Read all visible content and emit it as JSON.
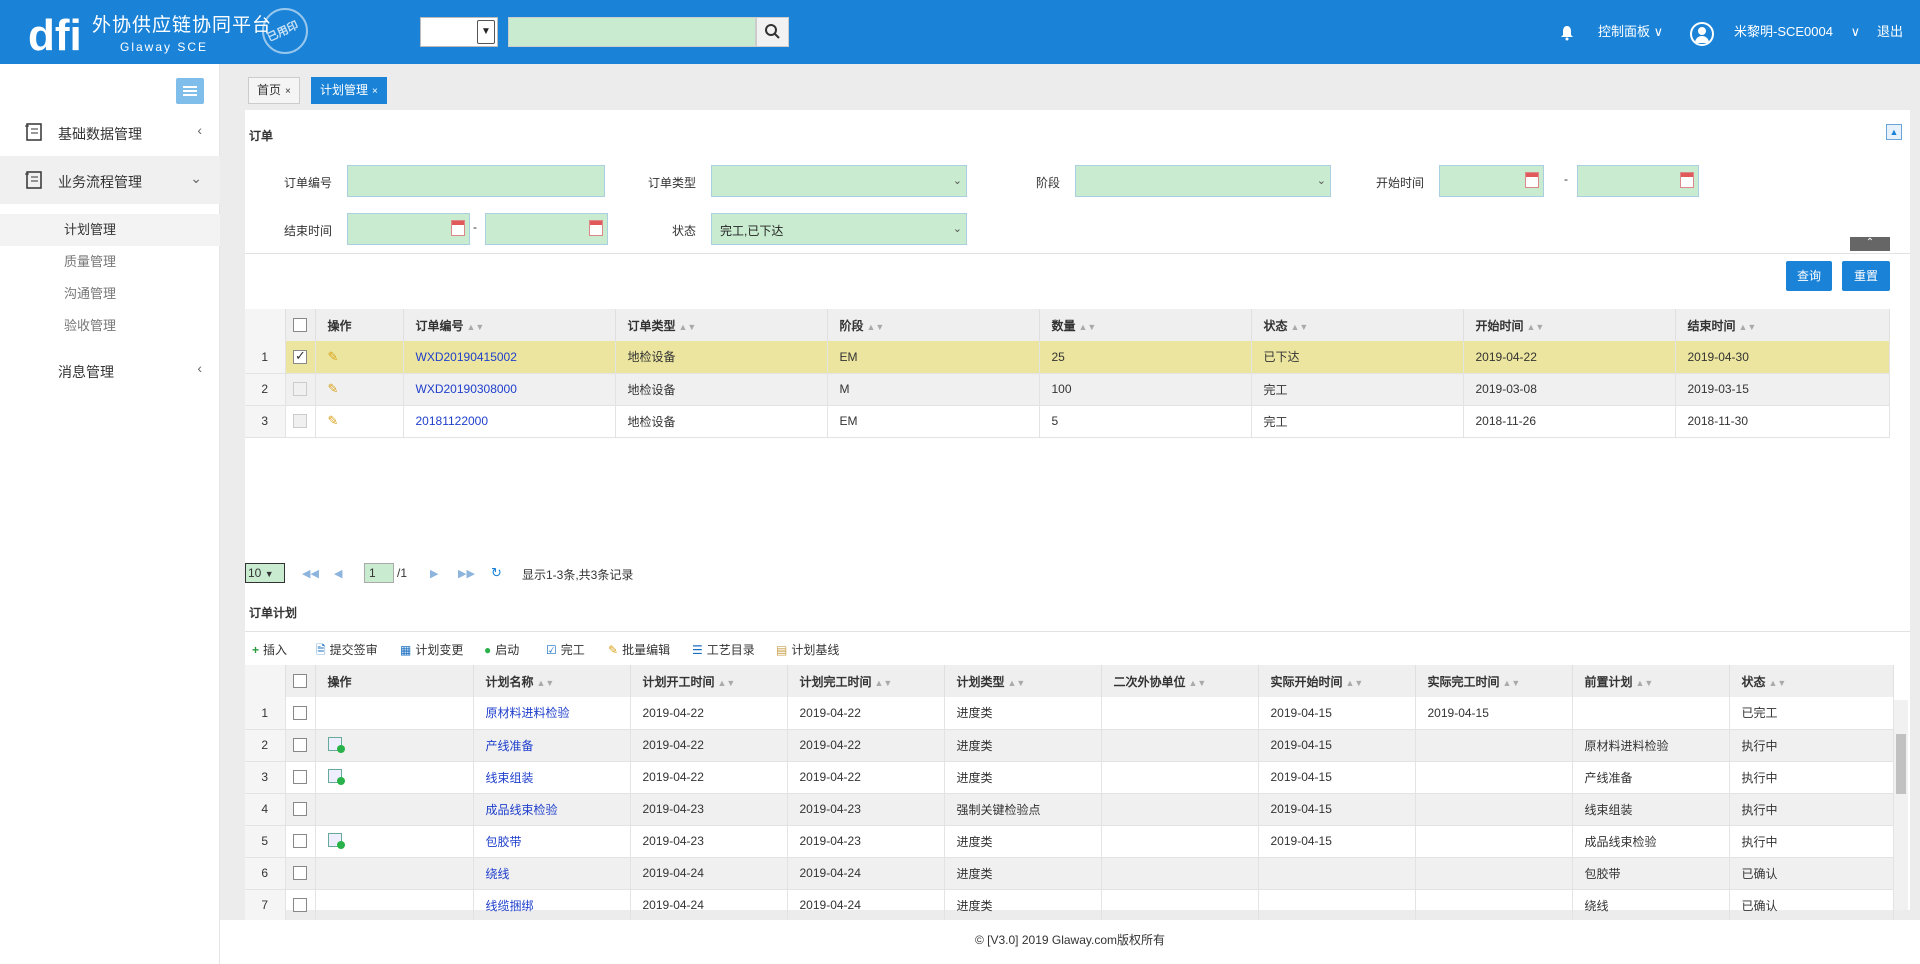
{
  "header": {
    "title": "外协供应链协同平台",
    "subtitle": "Glaway SCE",
    "stamp": "已用印",
    "search_select": "",
    "search_value": "",
    "control_panel": "控制面板",
    "user": "米黎明-SCE0004",
    "logout": "退出"
  },
  "sidebar": {
    "groups": [
      {
        "label": "基础数据管理"
      },
      {
        "label": "业务流程管理"
      },
      {
        "label": "消息管理"
      }
    ],
    "subitems": [
      "计划管理",
      "质量管理",
      "沟通管理",
      "验收管理"
    ]
  },
  "tabs": [
    {
      "label": "首页"
    },
    {
      "label": "计划管理"
    }
  ],
  "order_section": {
    "title": "订单",
    "form": {
      "order_no_label": "订单编号",
      "order_type_label": "订单类型",
      "stage_label": "阶段",
      "start_time_label": "开始时间",
      "end_time_label": "结束时间",
      "status_label": "状态",
      "status_value": "完工,已下达",
      "dash": "-"
    },
    "query_button": "查询",
    "reset_button": "重置",
    "columns": [
      "操作",
      "订单编号",
      "订单类型",
      "阶段",
      "数量",
      "状态",
      "开始时间",
      "结束时间"
    ],
    "rows": [
      {
        "no": "1",
        "order_no": "WXD20190415002",
        "type": "地检设备",
        "stage": "EM",
        "qty": "25",
        "status": "已下达",
        "start": "2019-04-22",
        "end": "2019-04-30"
      },
      {
        "no": "2",
        "order_no": "WXD20190308000",
        "type": "地检设备",
        "stage": "M",
        "qty": "100",
        "status": "完工",
        "start": "2019-03-08",
        "end": "2019-03-15"
      },
      {
        "no": "3",
        "order_no": "20181122000",
        "type": "地检设备",
        "stage": "EM",
        "qty": "5",
        "status": "完工",
        "start": "2018-11-26",
        "end": "2018-11-30"
      }
    ],
    "pager": {
      "page_size": "10",
      "current_page": "1",
      "total_pages": "/1",
      "summary": "显示1-3条,共3条记录"
    }
  },
  "plan_section": {
    "title": "订单计划",
    "toolbar": [
      "插入",
      "提交签审",
      "计划变更",
      "启动",
      "完工",
      "批量编辑",
      "工艺目录",
      "计划基线"
    ],
    "columns": [
      "操作",
      "计划名称",
      "计划开工时间",
      "计划完工时间",
      "计划类型",
      "二次外协单位",
      "实际开始时间",
      "实际完工时间",
      "前置计划",
      "状态"
    ],
    "rows": [
      {
        "no": "1",
        "name": "原材料进料检验",
        "plan_start": "2019-04-22",
        "plan_end": "2019-04-22",
        "type": "进度类",
        "sub": "",
        "act_start": "2019-04-15",
        "act_end": "2019-04-15",
        "pre": "",
        "status": "已完工",
        "icon": false
      },
      {
        "no": "2",
        "name": "产线准备",
        "plan_start": "2019-04-22",
        "plan_end": "2019-04-22",
        "type": "进度类",
        "sub": "",
        "act_start": "2019-04-15",
        "act_end": "",
        "pre": "原材料进料检验",
        "status": "执行中",
        "icon": true
      },
      {
        "no": "3",
        "name": "线束组装",
        "plan_start": "2019-04-22",
        "plan_end": "2019-04-22",
        "type": "进度类",
        "sub": "",
        "act_start": "2019-04-15",
        "act_end": "",
        "pre": "产线准备",
        "status": "执行中",
        "icon": true
      },
      {
        "no": "4",
        "name": "成品线束检验",
        "plan_start": "2019-04-23",
        "plan_end": "2019-04-23",
        "type": "强制关键检验点",
        "sub": "",
        "act_start": "2019-04-15",
        "act_end": "",
        "pre": "线束组装",
        "status": "执行中",
        "icon": false
      },
      {
        "no": "5",
        "name": "包胶带",
        "plan_start": "2019-04-23",
        "plan_end": "2019-04-23",
        "type": "进度类",
        "sub": "",
        "act_start": "2019-04-15",
        "act_end": "",
        "pre": "成品线束检验",
        "status": "执行中",
        "icon": true
      },
      {
        "no": "6",
        "name": "绕线",
        "plan_start": "2019-04-24",
        "plan_end": "2019-04-24",
        "type": "进度类",
        "sub": "",
        "act_start": "",
        "act_end": "",
        "pre": "包胶带",
        "status": "已确认",
        "icon": false
      },
      {
        "no": "7",
        "name": "线缆捆绑",
        "plan_start": "2019-04-24",
        "plan_end": "2019-04-24",
        "type": "进度类",
        "sub": "",
        "act_start": "",
        "act_end": "",
        "pre": "绕线",
        "status": "已确认",
        "icon": false
      }
    ]
  },
  "footer": "© [V3.0] 2019 Glaway.com版权所有",
  "colors": {
    "primary": "#1a83d8",
    "field_bg": "#c9ecd1",
    "selected_row": "#ebe59f",
    "link": "#1f3fcc"
  }
}
